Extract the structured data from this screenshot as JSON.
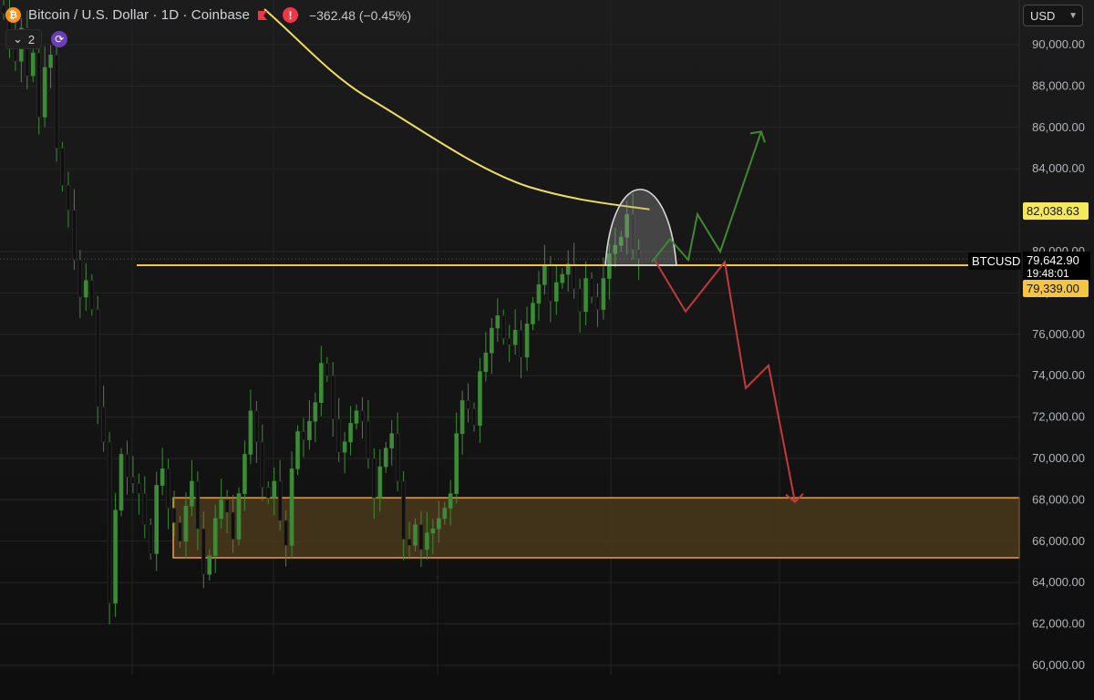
{
  "header": {
    "coin_symbol": "₿",
    "title": "Bitcoin / U.S. Dollar · 1D · Coinbase",
    "change": "−362.48 (−0.45%)",
    "alert_symbol": "!",
    "indicator_count": "2",
    "currency": "USD"
  },
  "colors": {
    "up": "#3d8b37",
    "down": "#0f0f0f",
    "ma": "#f0df5a",
    "level": "#f5c542",
    "zone_fill": "#4a3a1c",
    "zone_border": "#f0a030",
    "green_arrow": "#3f8a30",
    "red_arrow": "#c23a3a"
  },
  "price_tags": {
    "ma_value": "82,038.63",
    "symbol": "BTCUSD",
    "last_price": "79,642.90",
    "countdown": "19:48:01",
    "level_value": "79,339.00"
  },
  "chart_data": {
    "type": "candlestick",
    "title": "Bitcoin / U.S. Dollar · 1D · Coinbase",
    "y_axis": {
      "ticks": [
        "60,000.00",
        "62,000.00",
        "64,000.00",
        "66,000.00",
        "68,000.00",
        "70,000.00",
        "72,000.00",
        "74,000.00",
        "76,000.00",
        "78,000.00",
        "80,000.00",
        "84,000.00",
        "86,000.00",
        "88,000.00",
        "90,000.00"
      ],
      "ylim": [
        60000,
        91500
      ]
    },
    "candle_closes_approx": [
      91500,
      90200,
      89200,
      90800,
      88500,
      89600,
      86500,
      88900,
      89500,
      85000,
      83200,
      82000,
      79600,
      77800,
      78600,
      77200,
      72500,
      70800,
      63000,
      67500,
      70200,
      69100,
      68800,
      68300,
      66800,
      65400,
      68700,
      69500,
      67600,
      66900,
      66000,
      67700,
      68900,
      66600,
      64400,
      65300,
      67100,
      68000,
      67400,
      66100,
      68300,
      70200,
      72300,
      70800,
      68600,
      68100,
      68900,
      67000,
      65800,
      69500,
      71300,
      70900,
      71800,
      72700,
      74600,
      74000,
      71900,
      70300,
      70800,
      71700,
      72300,
      71800,
      70000,
      68100,
      69600,
      70500,
      71200,
      68900,
      66100,
      65800,
      66800,
      65600,
      66400,
      66600,
      67100,
      67600,
      68300,
      71200,
      72800,
      72400,
      71600,
      74200,
      75100,
      76300,
      76900,
      75800,
      75500,
      76200,
      74900,
      76500,
      77500,
      78400,
      79300,
      77600,
      78500,
      78900,
      79400,
      78200,
      77100,
      78700,
      77800,
      77200,
      78700,
      79900,
      80300,
      80700,
      81800,
      80100,
      79643
    ],
    "moving_average": {
      "points": [
        [
          21,
          84600
        ],
        [
          28,
          84200
        ],
        [
          40,
          83700
        ],
        [
          54,
          83000
        ],
        [
          64,
          82400
        ],
        [
          72,
          82040
        ]
      ],
      "last_value": 82038.63
    },
    "horizontal_level": 79339,
    "support_zone": [
      65200,
      68100
    ],
    "bullish_path": [
      79500,
      80600,
      79600,
      81800,
      80000,
      85800
    ],
    "bearish_path": [
      79600,
      77100,
      79500,
      73400,
      74500,
      67900
    ]
  }
}
